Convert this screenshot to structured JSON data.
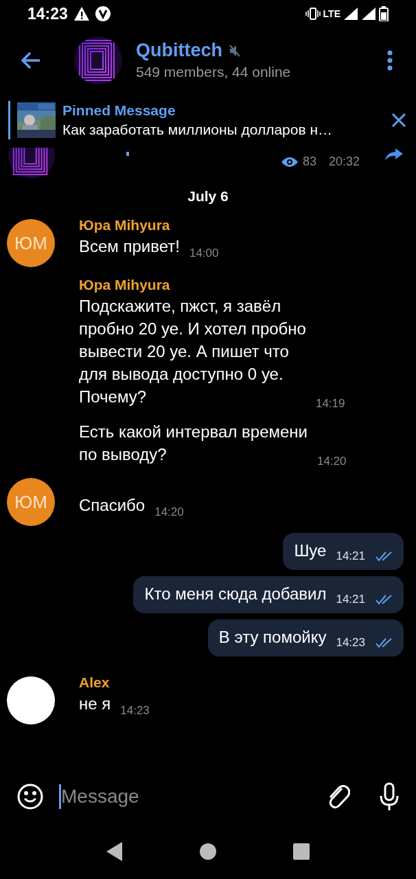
{
  "status_bar": {
    "time": "14:23",
    "network": "LTE"
  },
  "header": {
    "title": "Qubittech",
    "muted": true,
    "subtitle": "549 members, 44 online"
  },
  "pinned": {
    "title": "Pinned Message",
    "text": "Как заработать миллионы долларов н…"
  },
  "partial_post": {
    "views": "83",
    "time": "20:32"
  },
  "date": "July 6",
  "messages": [
    {
      "kind": "incoming",
      "sender": "Юра Mihyura",
      "text": "Всем привет!",
      "time": "14:00",
      "avatar": {
        "initials": "ЮМ",
        "color": "#e8861f"
      }
    },
    {
      "kind": "incoming",
      "sender": "Юра Mihyura",
      "text": "Подскажите, пжст, я завёл\nпробно 20 уе. И хотел пробно\nвывести 20 уе. А пишет что\nдля вывода доступно 0 уе.\nПочему?",
      "time": "14:19"
    },
    {
      "kind": "incoming",
      "text": "Есть какой интервал времени\nпо выводу?",
      "time": "14:20"
    },
    {
      "kind": "incoming",
      "text": "Спасибо",
      "time": "14:20",
      "avatar": {
        "initials": "ЮМ",
        "color": "#e8861f"
      }
    },
    {
      "kind": "outgoing",
      "text": "Шуе",
      "time": "14:21",
      "read": true
    },
    {
      "kind": "outgoing",
      "text": "Кто меня сюда добавил",
      "time": "14:21",
      "read": true
    },
    {
      "kind": "outgoing",
      "text": "В эту помойку",
      "time": "14:23",
      "read": true
    },
    {
      "kind": "incoming",
      "sender": "Alex",
      "text": "не я",
      "time": "14:23",
      "avatar": {
        "color": "#ffffff"
      }
    }
  ],
  "composer": {
    "placeholder": "Message"
  }
}
